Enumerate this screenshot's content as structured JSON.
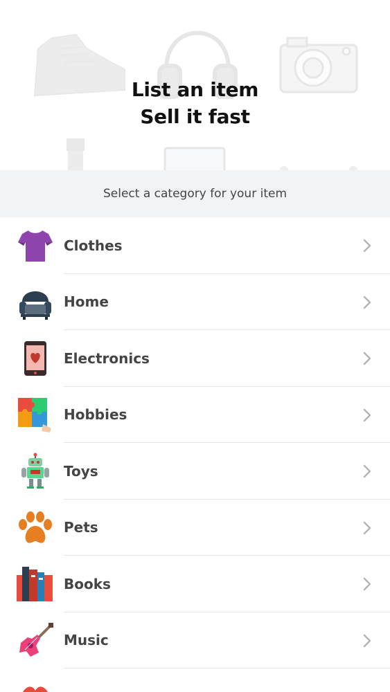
{
  "hero": {
    "title_line1": "List an item",
    "title_line2": "Sell it fast"
  },
  "category_prompt": "Select a category for your item",
  "categories": [
    {
      "label": "Clothes",
      "icon": "tshirt-icon"
    },
    {
      "label": "Home",
      "icon": "armchair-icon"
    },
    {
      "label": "Electronics",
      "icon": "smartphone-icon"
    },
    {
      "label": "Hobbies",
      "icon": "puzzle-icon"
    },
    {
      "label": "Toys",
      "icon": "robot-icon"
    },
    {
      "label": "Pets",
      "icon": "paw-icon"
    },
    {
      "label": "Books",
      "icon": "books-icon"
    },
    {
      "label": "Music",
      "icon": "guitar-icon"
    }
  ],
  "colors": {
    "header_bg": "#f1f3f5",
    "divider": "#e3e3e3",
    "chevron": "#b5b5b5"
  }
}
